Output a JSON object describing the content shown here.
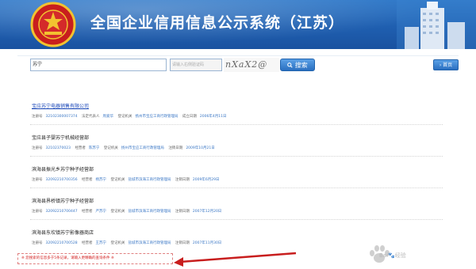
{
  "header": {
    "title": "全国企业信用信息公示系统（江苏）",
    "emblem_icon": "national-emblem-icon",
    "background_color": "#1f5fb0"
  },
  "search": {
    "query": "苏宁",
    "captcha_placeholder": "请输入右侧验证码",
    "captcha_text": "nXaX2@",
    "search_button": "搜索",
    "home_button": "首页",
    "search_icon": "magnifier-icon",
    "home_icon": "arrow-right-icon"
  },
  "results": [
    {
      "name": "宝应苏宁电器销售有限公司",
      "is_link": true,
      "meta": [
        {
          "label": "注册号",
          "value": "32102300007374"
        },
        {
          "label": "法定代表人",
          "value": "周爱华"
        },
        {
          "label": "登记机关",
          "value": "扬州市宝应工商行政管理局"
        },
        {
          "label": "成立日期",
          "value": "2006年4月11日"
        }
      ]
    },
    {
      "name": "宝应县子婴苏宁机械经营部",
      "is_link": false,
      "meta": [
        {
          "label": "注册号",
          "value": "32102370023"
        },
        {
          "label": "经营者",
          "value": "陈苏宁"
        },
        {
          "label": "登记机关",
          "value": "扬州市宝应工商行政管理局"
        },
        {
          "label": "注销日期",
          "value": "2009年10月21日"
        }
      ]
    },
    {
      "name": "滨海县振光乡苏宁种子经营部",
      "is_link": false,
      "meta": [
        {
          "label": "注册号",
          "value": "32092210700356"
        },
        {
          "label": "经营者",
          "value": "杨苏宁"
        },
        {
          "label": "登记机关",
          "value": "盐城市滨海工商行政管理局"
        },
        {
          "label": "注销日期",
          "value": "2009年6月29日"
        }
      ]
    },
    {
      "name": "滨海县界桥镇苏宁种子经营部",
      "is_link": false,
      "meta": [
        {
          "label": "注册号",
          "value": "32092210700447"
        },
        {
          "label": "经营者",
          "value": "严苏宁"
        },
        {
          "label": "登记机关",
          "value": "盐城市滨海工商行政管理局"
        },
        {
          "label": "注销日期",
          "value": "2007年12月20日"
        }
      ]
    },
    {
      "name": "滨海县东坎镇苏宁影像器商店",
      "is_link": false,
      "meta": [
        {
          "label": "注册号",
          "value": "32092210700528"
        },
        {
          "label": "经营者",
          "value": "王苏宁"
        },
        {
          "label": "登记机关",
          "value": "盐城市滨海工商行政管理局"
        },
        {
          "label": "注销日期",
          "value": "2007年11月30日"
        }
      ]
    }
  ],
  "note": "※ 您搜索的信息多于5条记录，请输入更精确的查询条件 ※",
  "watermark": "Bai🐾经验",
  "colors": {
    "link": "#1a47b8",
    "note_red": "#d32020",
    "button_blue": "#2a6fc0"
  }
}
